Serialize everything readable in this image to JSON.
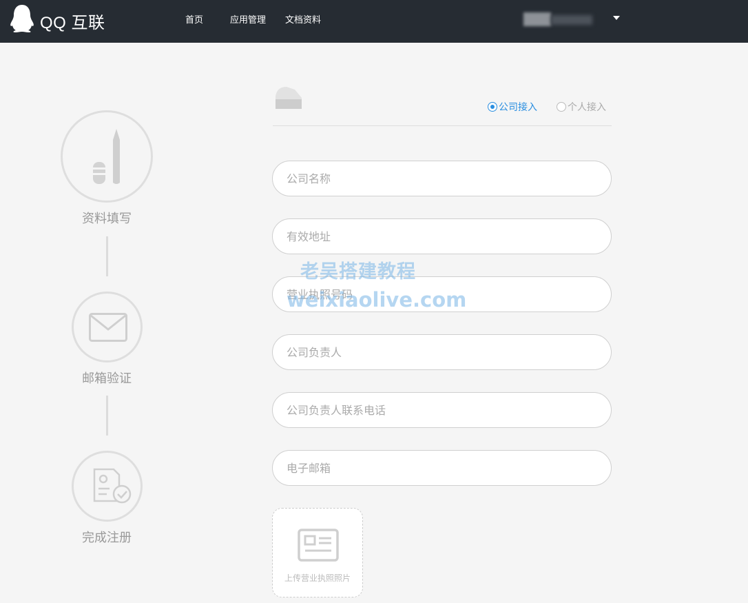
{
  "header": {
    "brand": "QQ 互联",
    "nav": [
      "首页",
      "应用管理",
      "文档资料"
    ]
  },
  "steps": [
    {
      "label": "资料填写",
      "icon": "pen-icon"
    },
    {
      "label": "邮箱验证",
      "icon": "envelope-icon"
    },
    {
      "label": "完成注册",
      "icon": "document-check-icon"
    }
  ],
  "access_type": {
    "options": [
      "公司接入",
      "个人接入"
    ],
    "selected": "公司接入"
  },
  "form": {
    "company_name_placeholder": "公司名称",
    "address_placeholder": "有效地址",
    "license_number_placeholder": "营业执照号码",
    "principal_placeholder": "公司负责人",
    "principal_phone_placeholder": "公司负责人联系电话",
    "email_placeholder": "电子邮箱",
    "upload_label": "上传营业执照照片"
  },
  "watermark": {
    "line1": "老吴搭建教程",
    "line2": "weixiaolive.com"
  },
  "colors": {
    "topbar": "#262c33",
    "accent": "#2a8ee0",
    "background": "#f5f5f5"
  }
}
